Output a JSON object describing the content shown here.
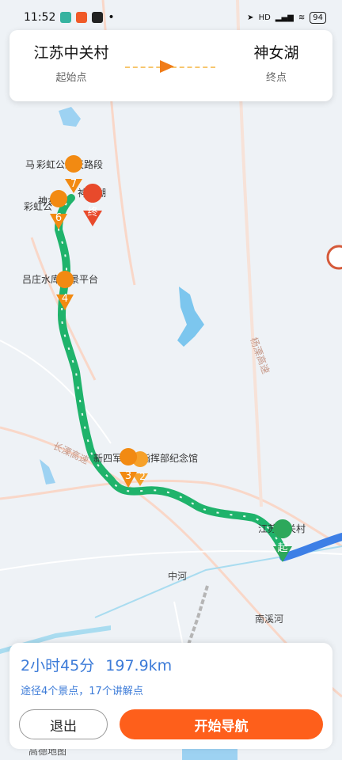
{
  "status": {
    "time": "11:52",
    "dot": "•",
    "network": "HD",
    "battery": "94"
  },
  "route": {
    "start_name": "江苏中关村",
    "start_sub": "起始点",
    "end_name": "神女湖",
    "end_sub": "终点"
  },
  "map": {
    "labels": {
      "rainbow_road": "彩虹公路天路段",
      "ma_prefix": "马",
      "shennv_lake": "神女湖",
      "shennv_short": "神女",
      "rainbow_short": "彩虹公",
      "lvzhuang": "吕庄水库观景平台",
      "yangli_highway": "杨溧高速",
      "changli_highway": "长溧高速",
      "memorial": "新四军江南指挥部纪念馆",
      "zgc": "江苏中关村",
      "zhonghe": "中河",
      "nanxi": "南溪河",
      "gaode": "高德地图"
    },
    "markers": {
      "m7": "7",
      "m6": "6",
      "m4": "4",
      "m3": "3",
      "m2": "2",
      "end": "终",
      "start": "起"
    }
  },
  "summary": {
    "duration": "2小时45分",
    "distance": "197.9km",
    "info": "途径4个景点，17个讲解点"
  },
  "buttons": {
    "exit": "退出",
    "start_nav": "开始导航"
  },
  "colors": {
    "route_green": "#1fb36b",
    "route_blue": "#3d7fe6",
    "accent_orange": "#fe5f1b",
    "summary_blue": "#3c7bd8"
  }
}
